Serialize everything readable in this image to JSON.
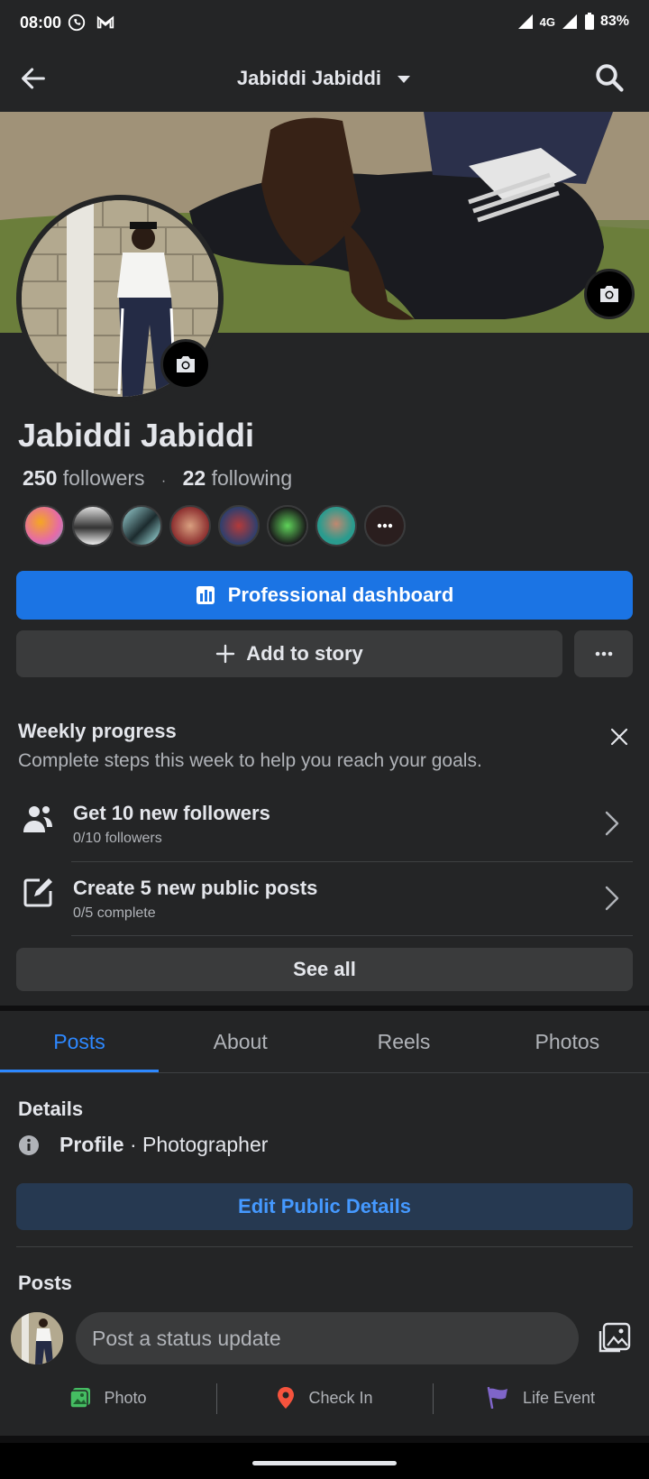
{
  "status_bar": {
    "time": "08:00",
    "network": "4G",
    "battery": "83%"
  },
  "header": {
    "title": "Jabiddi Jabiddi"
  },
  "profile": {
    "name": "Jabiddi Jabiddi",
    "followers_count": "250",
    "followers_label": "followers",
    "following_count": "22",
    "following_label": "following"
  },
  "buttons": {
    "professional_dashboard": "Professional dashboard",
    "add_to_story": "Add to story",
    "see_all": "See all",
    "edit_public_details": "Edit Public Details"
  },
  "weekly_progress": {
    "title": "Weekly progress",
    "subtitle": "Complete steps this week to help you reach your goals.",
    "tasks": [
      {
        "title": "Get 10 new followers",
        "sub": "0/10 followers",
        "icon": "people-icon"
      },
      {
        "title": "Create 5 new public posts",
        "sub": "0/5 complete",
        "icon": "edit-icon"
      }
    ]
  },
  "tabs": [
    {
      "label": "Posts",
      "active": true
    },
    {
      "label": "About",
      "active": false
    },
    {
      "label": "Reels",
      "active": false
    },
    {
      "label": "Photos",
      "active": false
    }
  ],
  "details": {
    "heading": "Details",
    "profile_label": "Profile",
    "profile_value": " · Photographer"
  },
  "posts": {
    "heading": "Posts",
    "placeholder": "Post a status update",
    "actions": [
      "Photo",
      "Check In",
      "Life Event"
    ]
  },
  "colors": {
    "background": "#242526",
    "accent": "#1b74e4",
    "tab_active": "#2d88ff"
  }
}
